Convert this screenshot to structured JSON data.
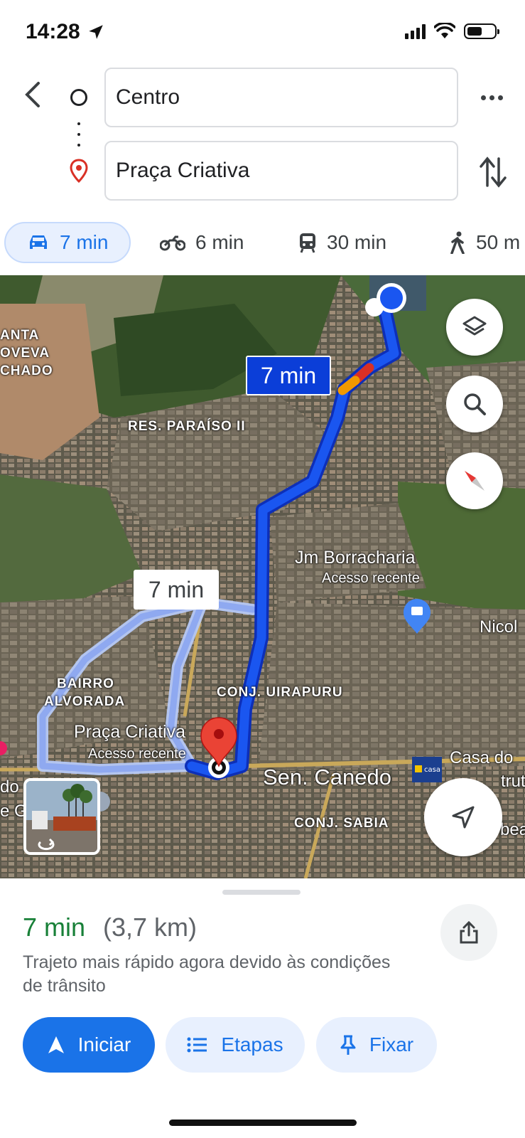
{
  "status_bar": {
    "time": "14:28"
  },
  "search": {
    "origin_value": "Centro",
    "destination_value": "Praça Criativa"
  },
  "modes": [
    {
      "name": "car",
      "label": "7 min",
      "selected": true
    },
    {
      "name": "motorcycle",
      "label": "6 min"
    },
    {
      "name": "transit",
      "label": "30 min"
    },
    {
      "name": "walk",
      "label": "50 m"
    }
  ],
  "map": {
    "route_time_primary": "7 min",
    "route_time_alt": "7 min",
    "labels": {
      "santa_genoveva": [
        "ANTA",
        "OVEVA",
        "CHADO"
      ],
      "res_paraiso": "RES. PARAÍSO II",
      "bairro_alvorada_1": "BAIRRO",
      "bairro_alvorada_2": "ALVORADA",
      "conj_uirapuru": "CONJ. UIRAPURU",
      "conj_sabia": "CONJ. SABIA",
      "sen_canedo": "Sen. Canedo",
      "nicol": "Nicol",
      "casa_do": "Casa do",
      "trut": "trut",
      "bea": "bea",
      "do_edge": "do",
      "e_edge": "e G",
      "casa_logo": "casa"
    },
    "places": {
      "jm_borracharia": "Jm Borracharia",
      "jm_sub": "Acesso recente",
      "praca_criativa": "Praça Criativa",
      "praca_sub": "Acesso recente"
    }
  },
  "sheet": {
    "eta": "7 min",
    "distance": "(3,7 km)",
    "description": "Trajeto mais rápido agora devido às condições de trânsito",
    "buttons": {
      "start": "Iniciar",
      "steps": "Etapas",
      "pin": "Fixar"
    }
  },
  "colors": {
    "route_primary": "#1a56f0",
    "route_alt": "#9db7f5",
    "accent": "#1a73e8",
    "eta_green": "#188038",
    "traffic_orange": "#f29900",
    "traffic_red": "#d93025"
  }
}
